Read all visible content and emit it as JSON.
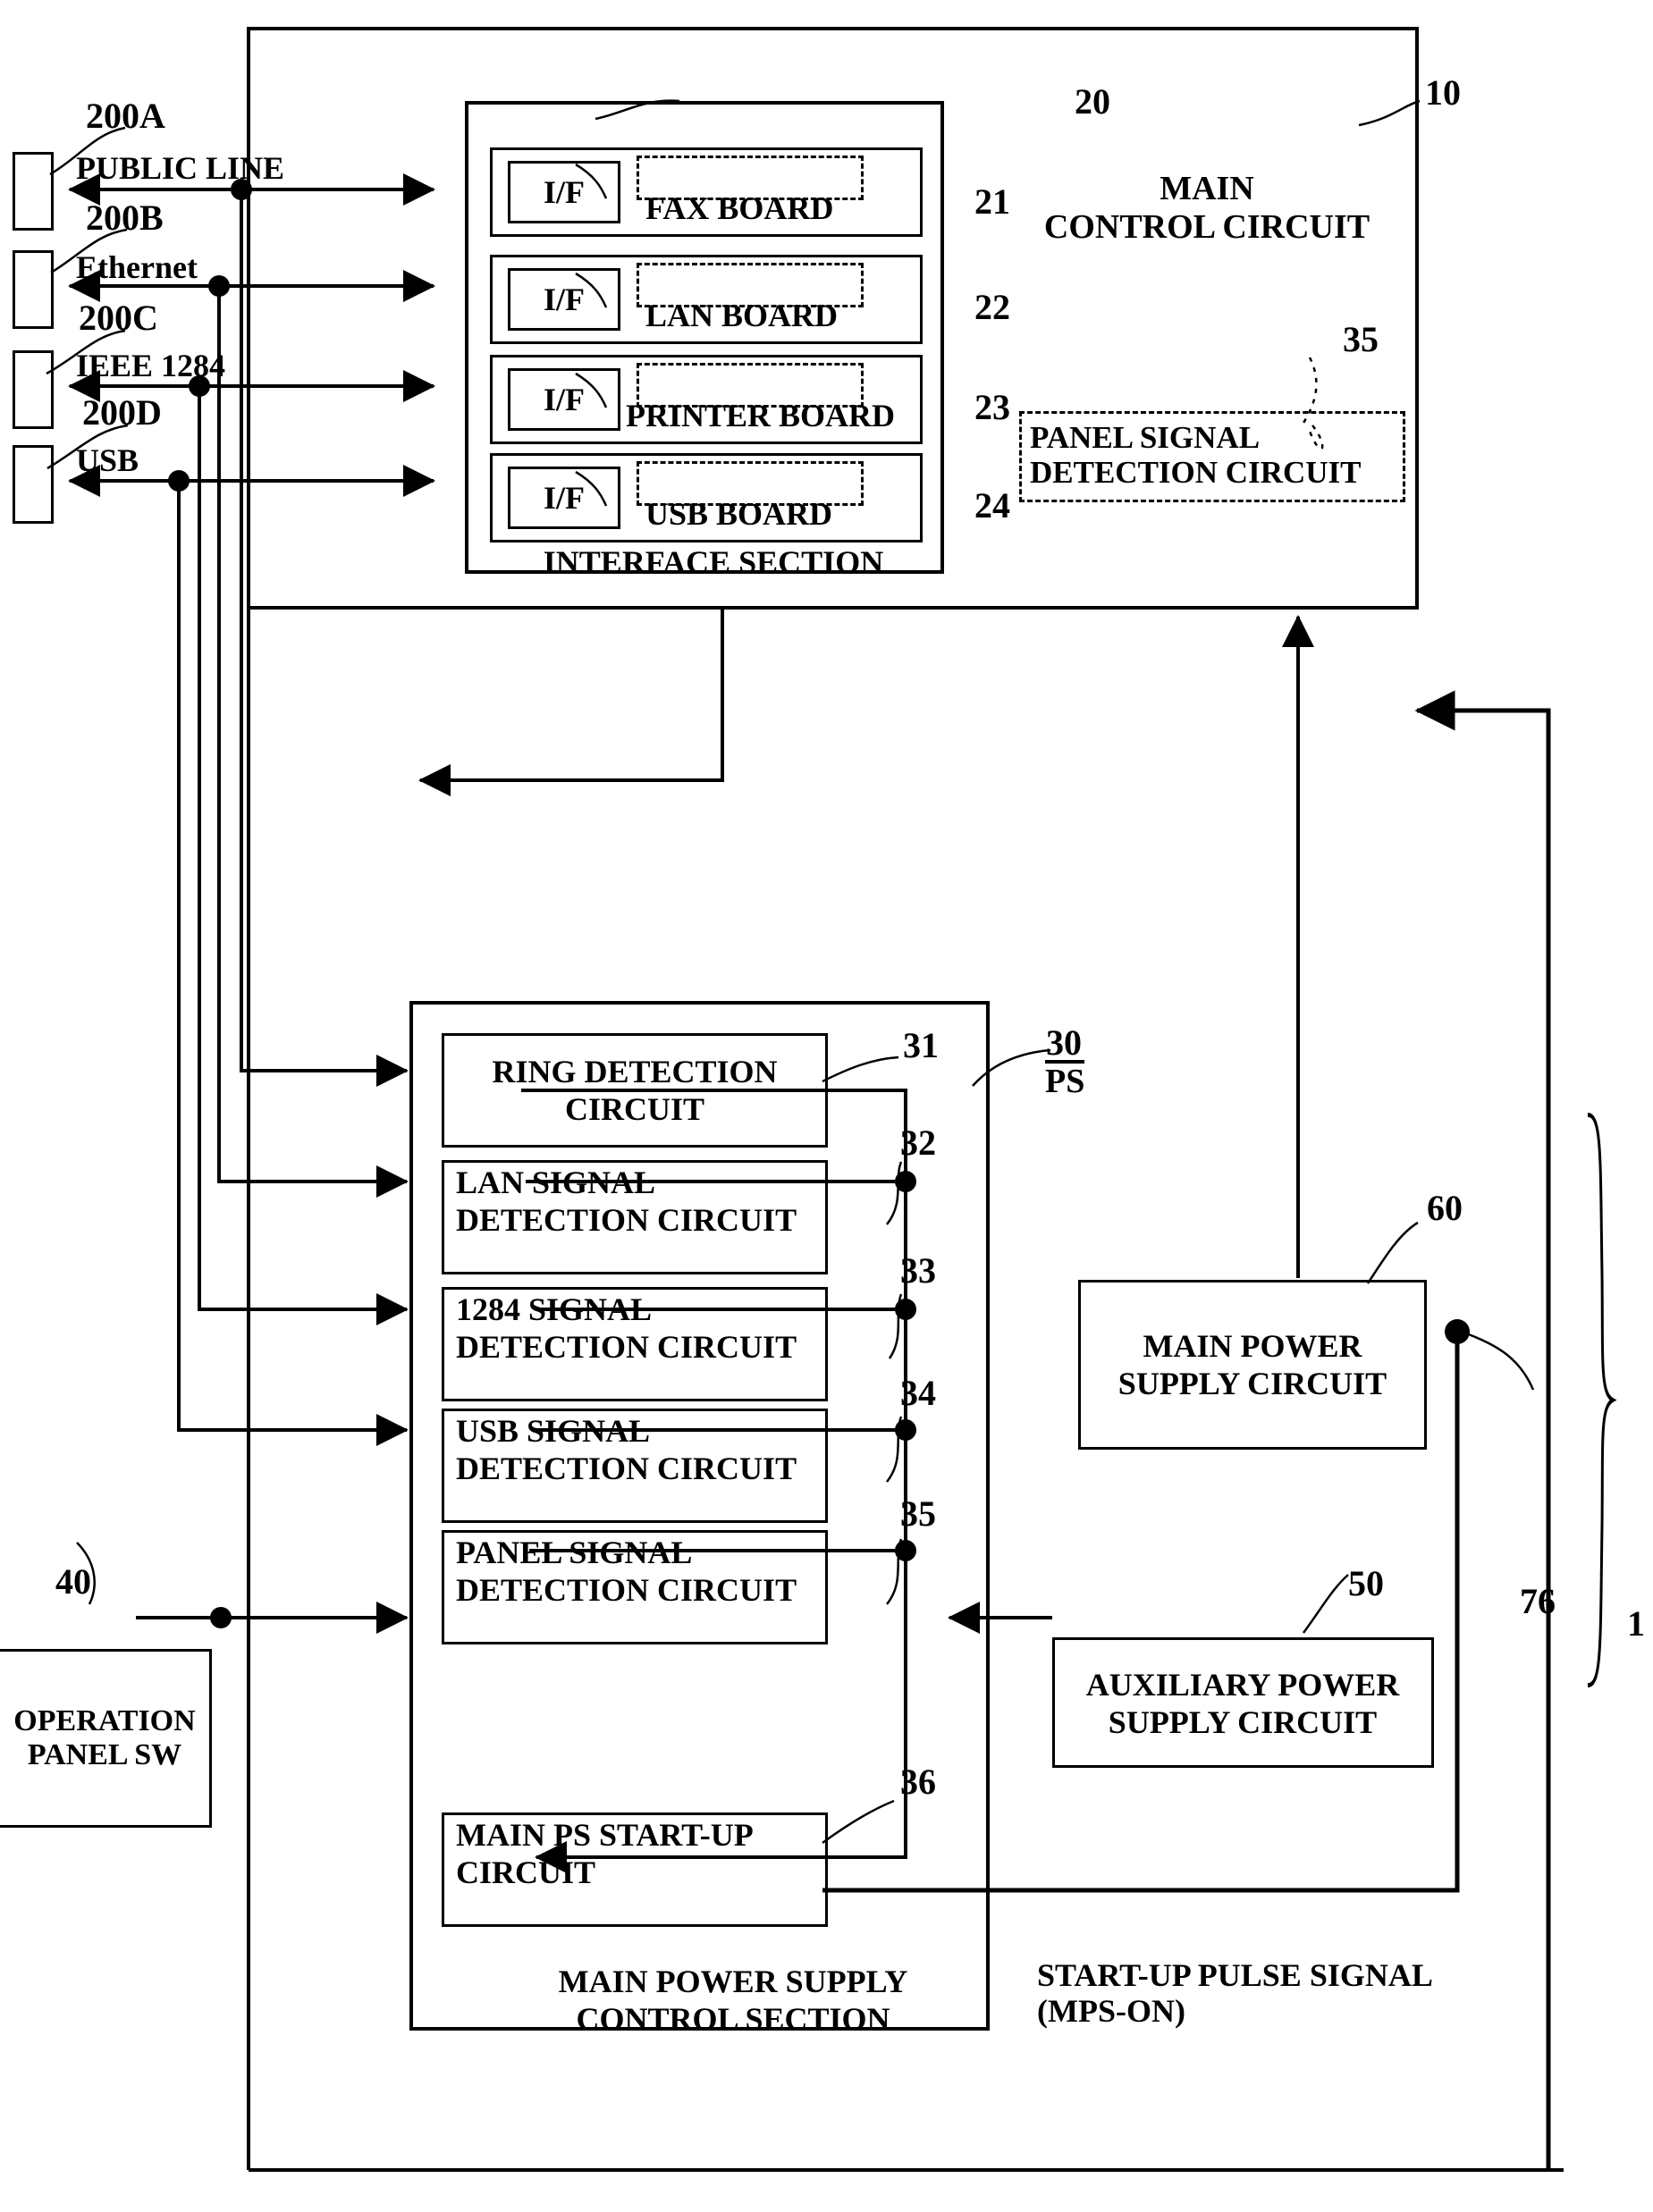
{
  "figure": {
    "system_ref": "1",
    "title_hidden": ""
  },
  "external_ports": [
    {
      "ref": "200A",
      "signal": "PUBLIC LINE"
    },
    {
      "ref": "200B",
      "signal": "Ethernet"
    },
    {
      "ref": "200C",
      "signal": "IEEE 1284"
    },
    {
      "ref": "200D",
      "signal": "USB"
    }
  ],
  "main_control_circuit": {
    "ref": "10",
    "label_line1": "MAIN",
    "label_line2": "CONTROL CIRCUIT",
    "panel_detection": {
      "ref": "35",
      "line1": "PANEL SIGNAL",
      "line2": "DETECTION CIRCUIT"
    }
  },
  "interface_section": {
    "ref": "20",
    "label": "INTERFACE SECTION",
    "if_label": "I/F",
    "boards": [
      {
        "ref": "21",
        "name": "FAX BOARD"
      },
      {
        "ref": "22",
        "name": "LAN BOARD"
      },
      {
        "ref": "23",
        "name": "PRINTER BOARD"
      },
      {
        "ref": "24",
        "name": "USB BOARD"
      }
    ]
  },
  "main_power_supply_control_section": {
    "ref": "30",
    "label_line1": "MAIN POWER SUPPLY",
    "label_line2": "CONTROL SECTION",
    "ps_signal": "PS",
    "circuits": [
      {
        "ref": "31",
        "line1": "RING DETECTION",
        "line2": "CIRCUIT",
        "centered": true
      },
      {
        "ref": "32",
        "line1": "LAN SIGNAL",
        "line2": "DETECTION CIRCUIT",
        "centered": false
      },
      {
        "ref": "33",
        "line1": "1284 SIGNAL",
        "line2": "DETECTION CIRCUIT",
        "centered": false
      },
      {
        "ref": "34",
        "line1": "USB SIGNAL",
        "line2": "DETECTION CIRCUIT",
        "centered": false
      },
      {
        "ref": "35",
        "line1": "PANEL SIGNAL",
        "line2": "DETECTION CIRCUIT",
        "centered": false
      },
      {
        "ref": "36",
        "line1": "MAIN PS START-UP",
        "line2": "CIRCUIT",
        "centered": false
      }
    ]
  },
  "operation_panel_switch": {
    "ref": "40",
    "line1": "OPERATION",
    "line2": "PANEL SW"
  },
  "auxiliary_power_supply_circuit": {
    "ref": "50",
    "line1": "AUXILIARY POWER",
    "line2": "SUPPLY CIRCUIT"
  },
  "main_power_supply_circuit": {
    "ref": "60",
    "line1": "MAIN POWER",
    "line2": "SUPPLY CIRCUIT"
  },
  "startup_pulse_signal": {
    "ref": "76",
    "line1": "START-UP PULSE SIGNAL",
    "line2": "(MPS-ON)"
  }
}
